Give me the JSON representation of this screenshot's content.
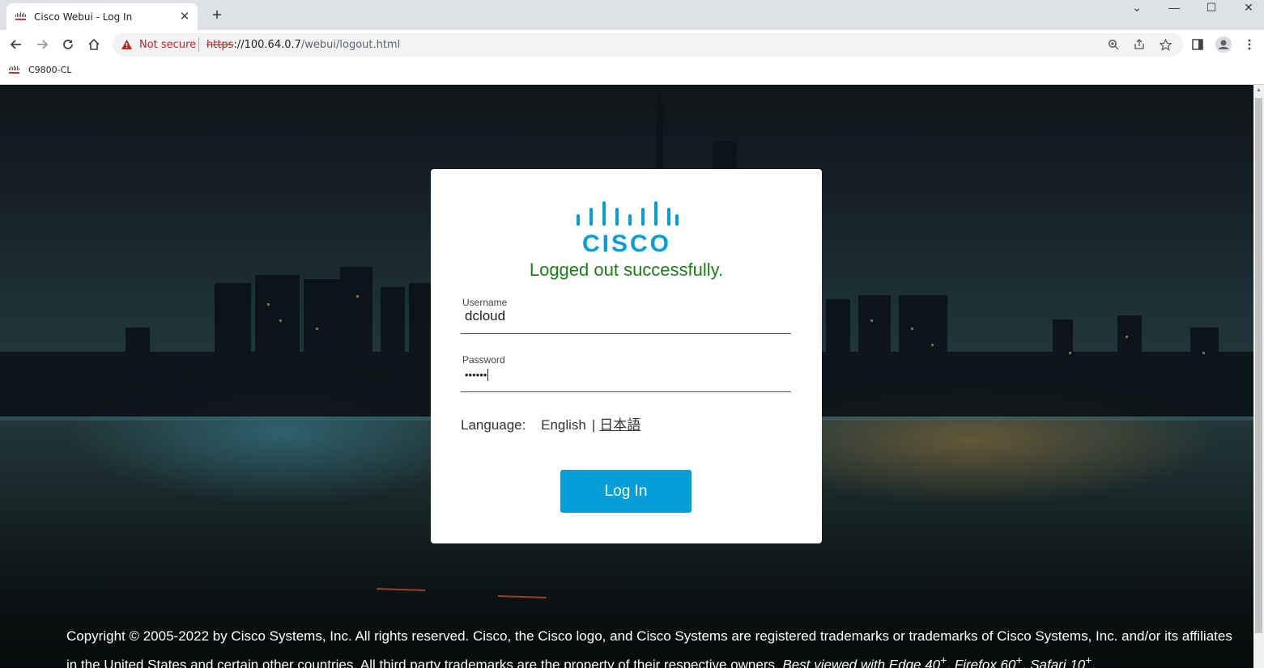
{
  "browser": {
    "tab_title": "Cisco Webui - Log In",
    "not_secure": "Not secure",
    "url_scheme": "https",
    "url_host": "://100.64.0.7",
    "url_path": "/webui/logout.html",
    "bookmark": "C9800-CL"
  },
  "login": {
    "logo_text": "CISCO",
    "status_message": "Logged out successfully.",
    "username_label": "Username",
    "username_value": "dcloud",
    "password_label": "Password",
    "password_value": "••••••",
    "language_label": "Language:",
    "lang_english": "English",
    "lang_separator": "|",
    "lang_japanese": "日本語",
    "login_button": "Log In"
  },
  "footer": {
    "copyright": "Copyright © 2005-2022 by Cisco Systems, Inc. All rights reserved. Cisco, the Cisco logo, and Cisco Systems are registered trademarks or trademarks of Cisco Systems, Inc. and/or its affiliates in the United States and certain other countries. All third party trademarks are the property of their respective owners.",
    "best_viewed": "Best viewed with Edge 40",
    "firefox": "Firefox 60",
    "safari": "Safari 10",
    "plus": "+"
  },
  "colors": {
    "accent": "#049fd9",
    "status_green": "#1a7f1a",
    "warning_red": "#c5221f"
  }
}
